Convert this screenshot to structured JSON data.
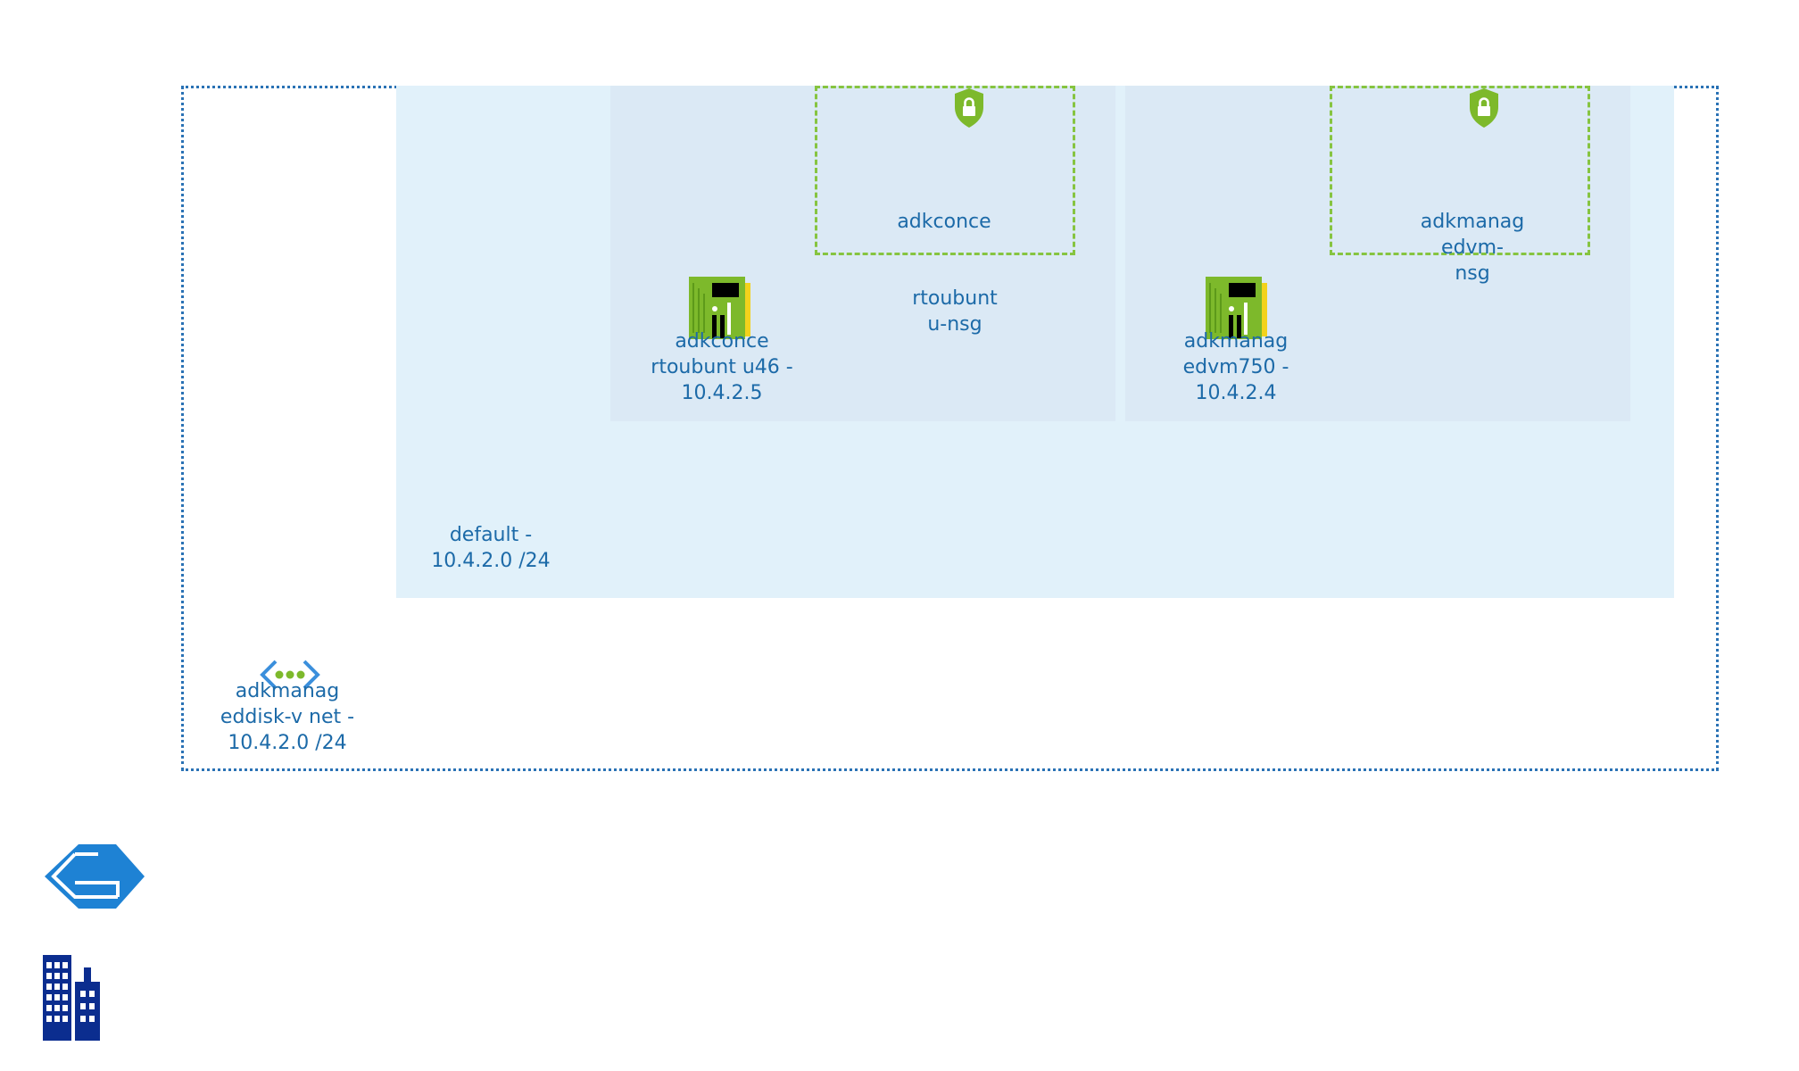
{
  "vnet": {
    "label": "adkmanag\neddisk-v net -\n10.4.2.0 /24",
    "icon": "virtual-network-icon"
  },
  "subnet": {
    "label": "default -\n10.4.2.0 /24"
  },
  "nics": [
    {
      "label": "adkconce\nrtoubunt u46 -\n10.4.2.5",
      "icon": "network-interface-icon"
    },
    {
      "label": "adkmanag\nedvm750 -\n10.4.2.4",
      "icon": "network-interface-icon"
    }
  ],
  "nsgs": [
    {
      "label_top": "adkconce",
      "label_bottom": "rtoubunt\nu-nsg",
      "icon": "shield-lock-icon"
    },
    {
      "label": "adkmanag\nedvm-\nnsg",
      "icon": "shield-lock-icon"
    }
  ],
  "legend": {
    "cloud_icon": "azure-cloud-icon",
    "building_icon": "on-premises-building-icon"
  },
  "colors": {
    "vnet_border": "#2a72b5",
    "subnet_fill": "#e1f1fa",
    "nic_group_fill": "#dbe9f5",
    "nsg_border": "#86c440",
    "text": "#1c6aa8",
    "nic_green": "#7db92b",
    "shield_green": "#7db92b",
    "building_navy": "#0b2d8f",
    "cloud_blue": "#1e82d4"
  }
}
